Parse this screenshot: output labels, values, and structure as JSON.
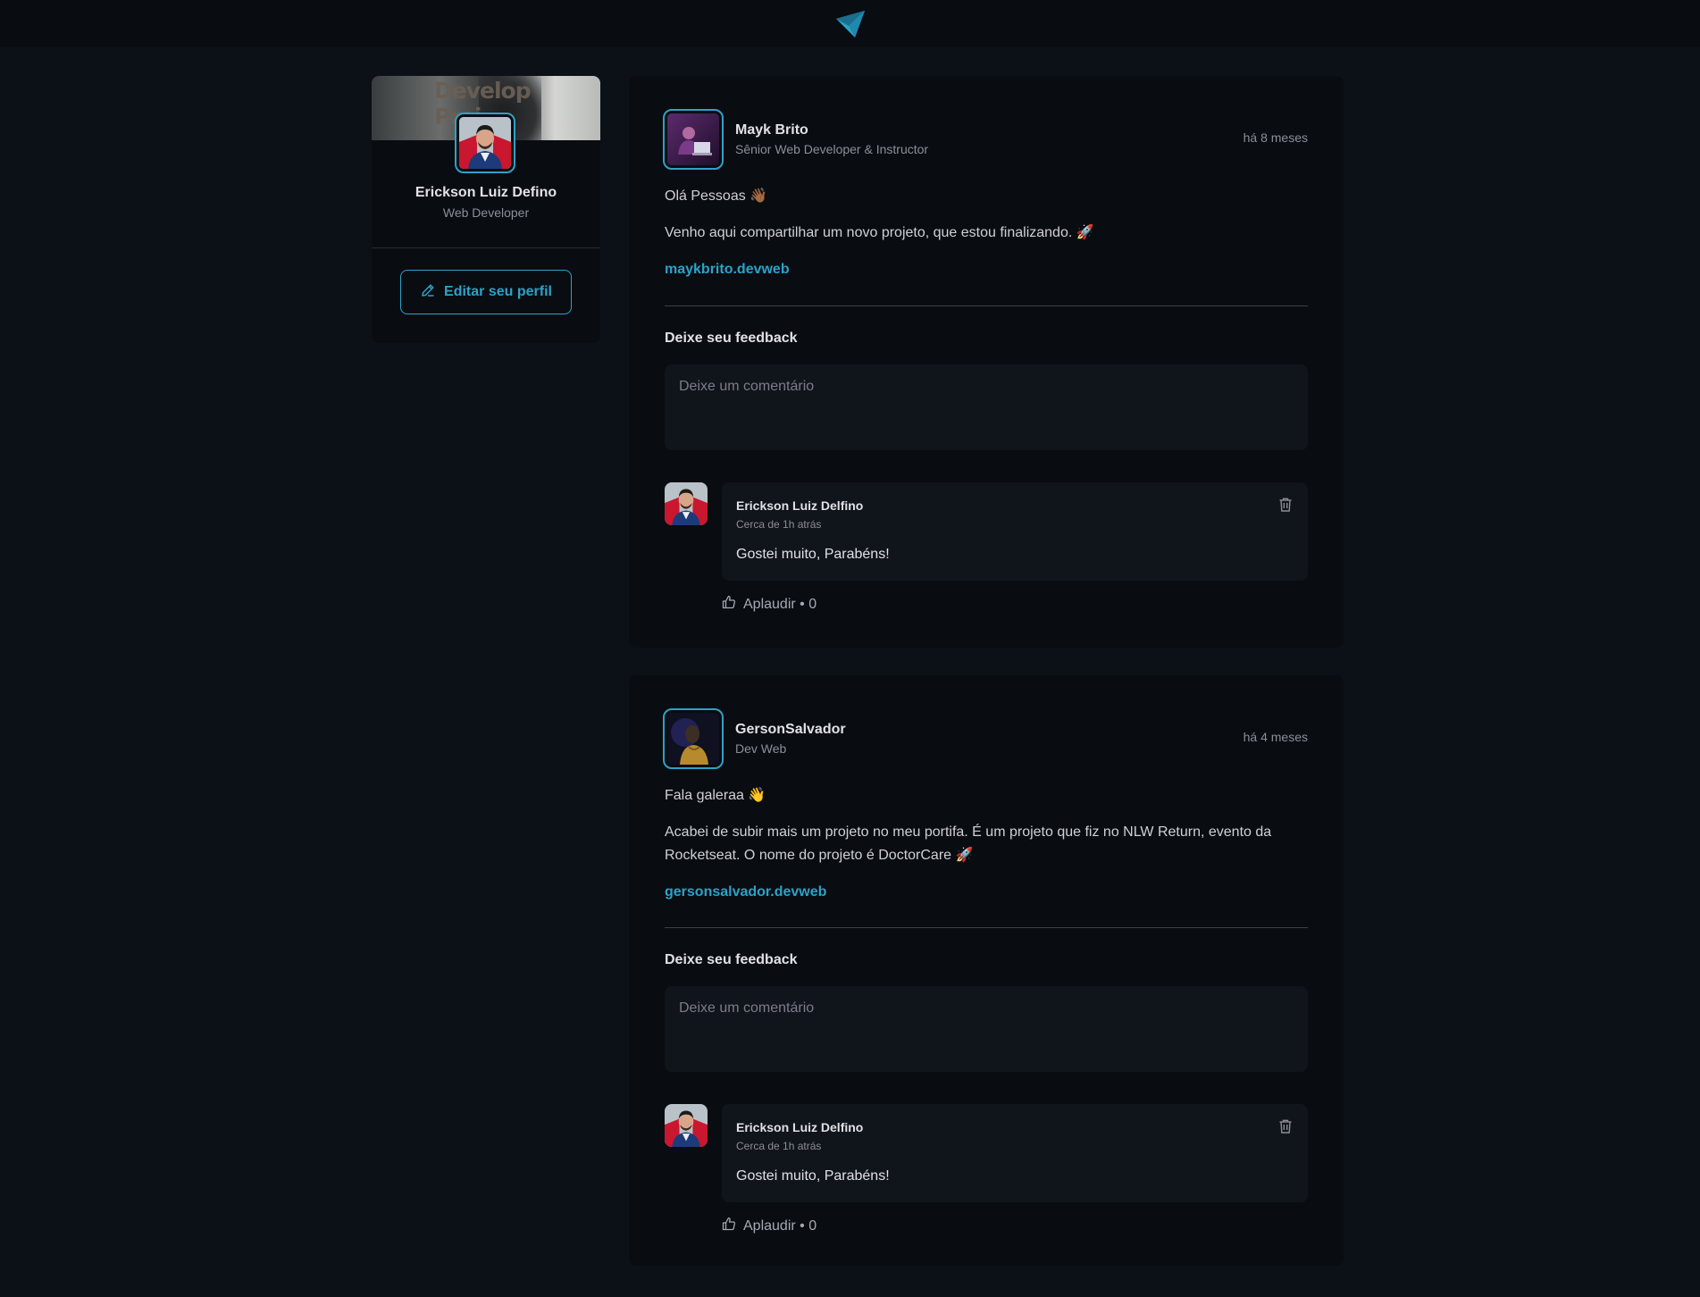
{
  "colors": {
    "accent": "#2ea1c8",
    "background": "#0b1116",
    "card": "#090d11"
  },
  "profile": {
    "cover_text": "Develop\nProj",
    "name": "Erickson Luiz Defino",
    "role": "Web Developer",
    "edit_label": "Editar seu perfil"
  },
  "posts": [
    {
      "author": {
        "name": "Mayk Brito",
        "role": "Sênior Web Developer & Instructor"
      },
      "time": "há 8 meses",
      "paragraphs": [
        "Olá Pessoas 👋🏾",
        "Venho aqui compartilhar um novo projeto, que estou finalizando. 🚀"
      ],
      "link": "maykbrito.devweb",
      "feedback_title": "Deixe seu feedback",
      "comment_placeholder": "Deixe um comentário",
      "comment": {
        "author": "Erickson Luiz Delfino",
        "time": "Cerca de 1h atrás",
        "text": "Gostei muito, Parabéns!",
        "applaud": "Aplaudir • 0"
      }
    },
    {
      "author": {
        "name": "GersonSalvador",
        "role": "Dev Web"
      },
      "time": "há 4 meses",
      "paragraphs": [
        "Fala galeraa 👋",
        "Acabei de subir mais um projeto no meu portifa. É um projeto que fiz no NLW Return, evento da Rocketseat. O nome do projeto é DoctorCare 🚀"
      ],
      "link": "gersonsalvador.devweb",
      "feedback_title": "Deixe seu feedback",
      "comment_placeholder": "Deixe um comentário",
      "comment": {
        "author": "Erickson Luiz Delfino",
        "time": "Cerca de 1h atrás",
        "text": "Gostei muito, Parabéns!",
        "applaud": "Aplaudir • 0"
      }
    }
  ]
}
